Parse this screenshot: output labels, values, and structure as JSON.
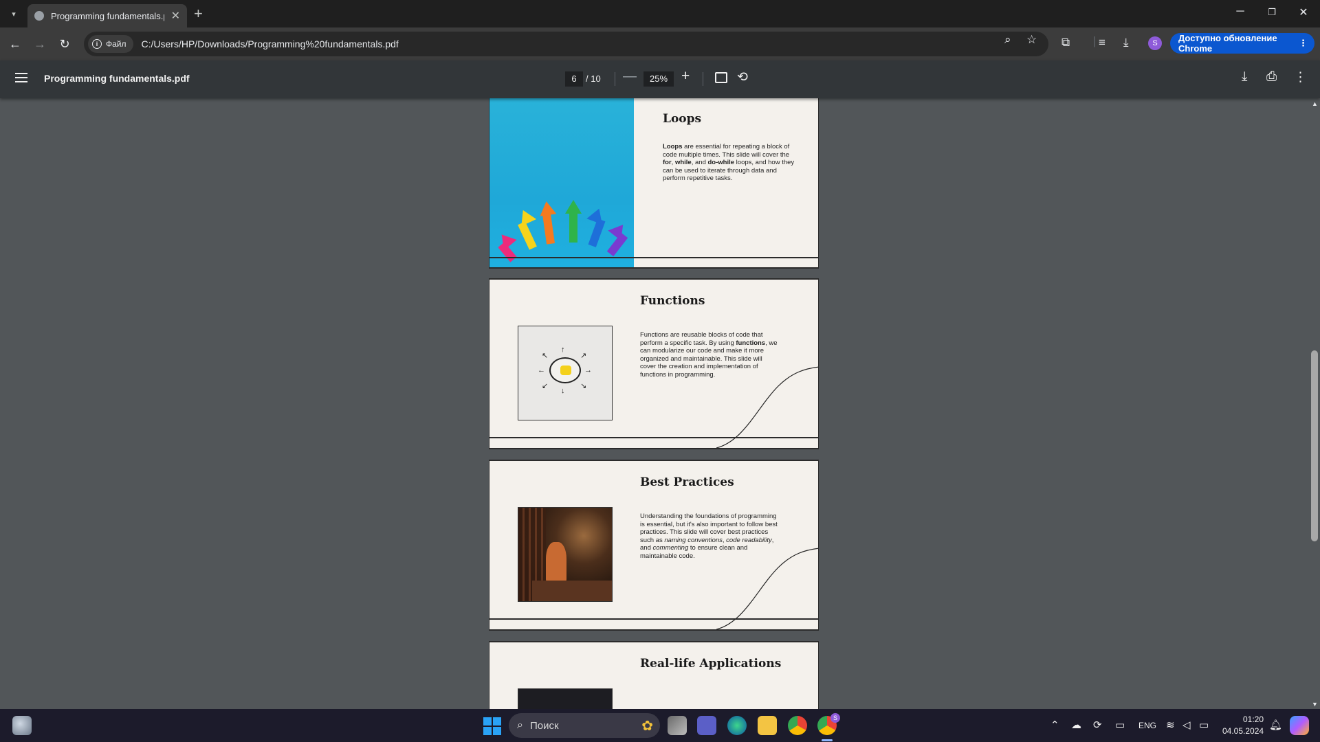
{
  "browser": {
    "tab_title": "Programming fundamentals.p",
    "new_tab_label": "+",
    "chip_label": "Файл",
    "url": "C:/Users/HP/Downloads/Programming%20fundamentals.pdf",
    "profile_initial": "S",
    "update_label": "Доступно обновление Chrome"
  },
  "pdf": {
    "filename": "Programming fundamentals.pdf",
    "current_page": "6",
    "total_pages": "/ 10",
    "zoom": "25%"
  },
  "slides": {
    "loops": {
      "title": "Loops",
      "body_parts": [
        "Loops",
        " are essential for repeating a block of code multiple times. This slide will cover the ",
        "for",
        ", ",
        "while",
        ", and ",
        "do-while",
        " loops, and how they can be used to iterate through data and perform repetitive tasks."
      ]
    },
    "functions": {
      "title": "Functions",
      "body_parts": [
        "Functions are reusable blocks of code that perform a specific task. By using ",
        "functions",
        ", we can modularize our code and make it more organized and maintainable. This slide will cover the creation and implementation of functions in programming."
      ]
    },
    "best_practices": {
      "title": "Best Practices",
      "body_parts": [
        "Understanding the foundations of programming is essential, but it's also important to follow best practices. This slide will cover best practices such as ",
        "naming conventions",
        ", ",
        "code readability",
        ", and ",
        "commenting",
        " to ensure clean and maintainable code."
      ]
    },
    "real_life": {
      "title": "Real-life Applications"
    }
  },
  "taskbar": {
    "search_placeholder": "Поиск",
    "language": "ENG",
    "time": "01:20",
    "date": "04.05.2024",
    "chrome_badge": "S"
  },
  "colors": {
    "accent": "#0b57d0",
    "viewer_bg": "#525659",
    "pdf_toolbar": "#323639",
    "slide_bg": "#f4f1ec"
  }
}
